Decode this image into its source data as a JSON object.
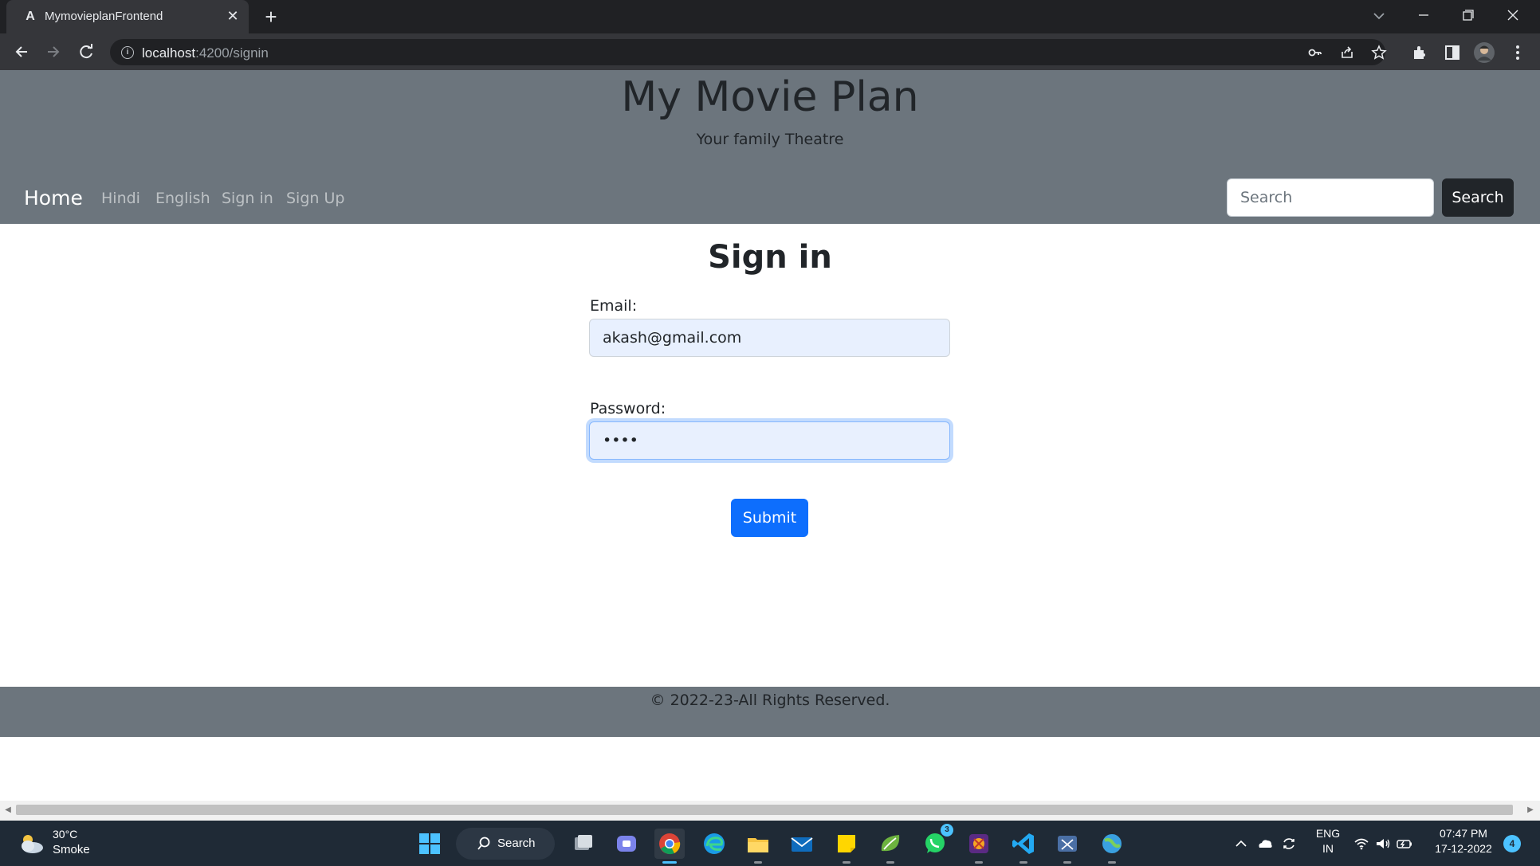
{
  "browser": {
    "tab_title": "MymovieplanFrontend",
    "tab_favicon": "A",
    "url_host": "localhost",
    "url_path": ":4200/signin",
    "icons": [
      "tab-search-icon",
      "minimize-icon",
      "restore-icon",
      "close-window-icon",
      "back-icon",
      "forward-icon",
      "reload-icon",
      "site-info-icon",
      "key-icon",
      "share-icon",
      "bookmark-star-icon",
      "extensions-icon",
      "side-panel-icon",
      "profile-avatar",
      "menu-icon"
    ]
  },
  "header": {
    "title": "My Movie Plan",
    "subtitle": "Your family Theatre"
  },
  "navbar": {
    "brand": "Home",
    "links": [
      "Hindi",
      "English",
      "Sign in",
      "Sign Up"
    ],
    "search_placeholder": "Search",
    "search_button": "Search"
  },
  "signin": {
    "heading": "Sign in",
    "email_label": "Email:",
    "email_value": "akash@gmail.com",
    "password_label": "Password:",
    "password_value": "••••",
    "submit_label": "Submit"
  },
  "footer": {
    "text": "© 2022-23-All Rights Reserved."
  },
  "taskbar": {
    "weather_temp": "30°C",
    "weather_desc": "Smoke",
    "search_label": "Search",
    "whatsapp_badge": "3",
    "lang_top": "ENG",
    "lang_bottom": "IN",
    "time": "07:47 PM",
    "date": "17-12-2022",
    "notification_count": "4"
  },
  "colors": {
    "header_bg": "#6c757d",
    "primary": "#0d6efd",
    "dark_button": "#212529",
    "autofill_bg": "#e8f0fe"
  }
}
